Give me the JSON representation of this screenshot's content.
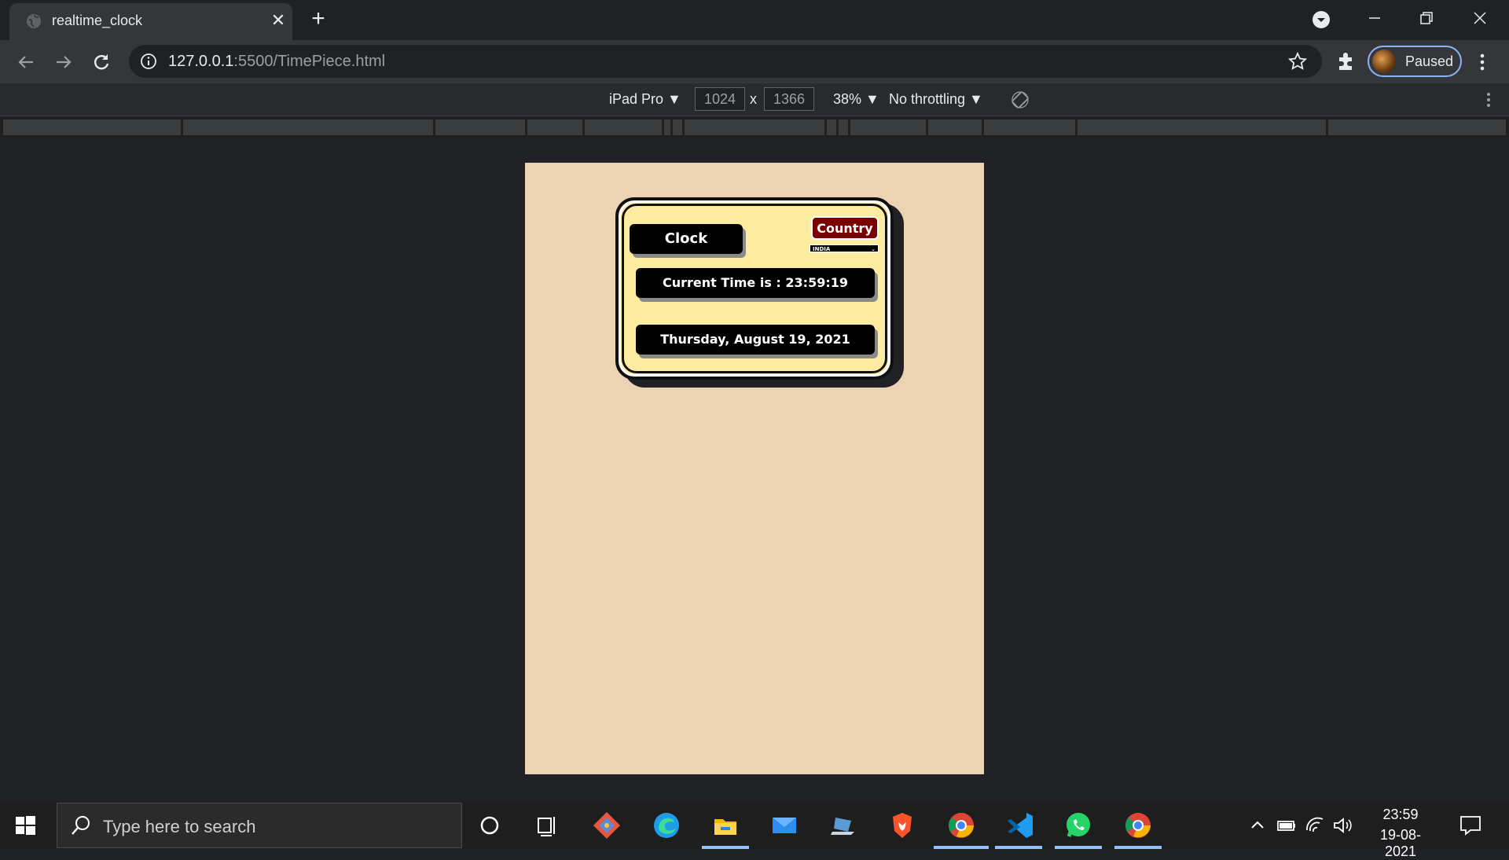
{
  "browser": {
    "tab_title": "realtime_clock",
    "url_host": "127.0.0.1",
    "url_rest": ":5500/TimePiece.html",
    "profile_label": "Paused"
  },
  "devtools": {
    "device": "iPad Pro ▼",
    "width": "1024",
    "times": "x",
    "height": "1366",
    "zoom": "38% ▼",
    "throttling": "No throttling ▼"
  },
  "app": {
    "clock_label": "Clock",
    "country_label": "Country",
    "country_selected": "INDIA",
    "time_text": "Current Time is : 23:59:19",
    "date_text": "Thursday, August 19, 2021",
    "colors": {
      "page_bg": "#ecd3b3",
      "card_bg": "#fdeba0",
      "country_bg": "#7a0000"
    }
  },
  "taskbar": {
    "search_placeholder": "Type here to search",
    "time": "23:59",
    "date": "19-08-2021",
    "icons": [
      "cortana-icon",
      "task-view-icon",
      "git-icon",
      "edge-icon",
      "file-explorer-icon",
      "mail-icon",
      "laptop-app-icon",
      "brave-icon",
      "chrome-icon",
      "vscode-icon",
      "whatsapp-icon",
      "chrome-icon"
    ]
  }
}
